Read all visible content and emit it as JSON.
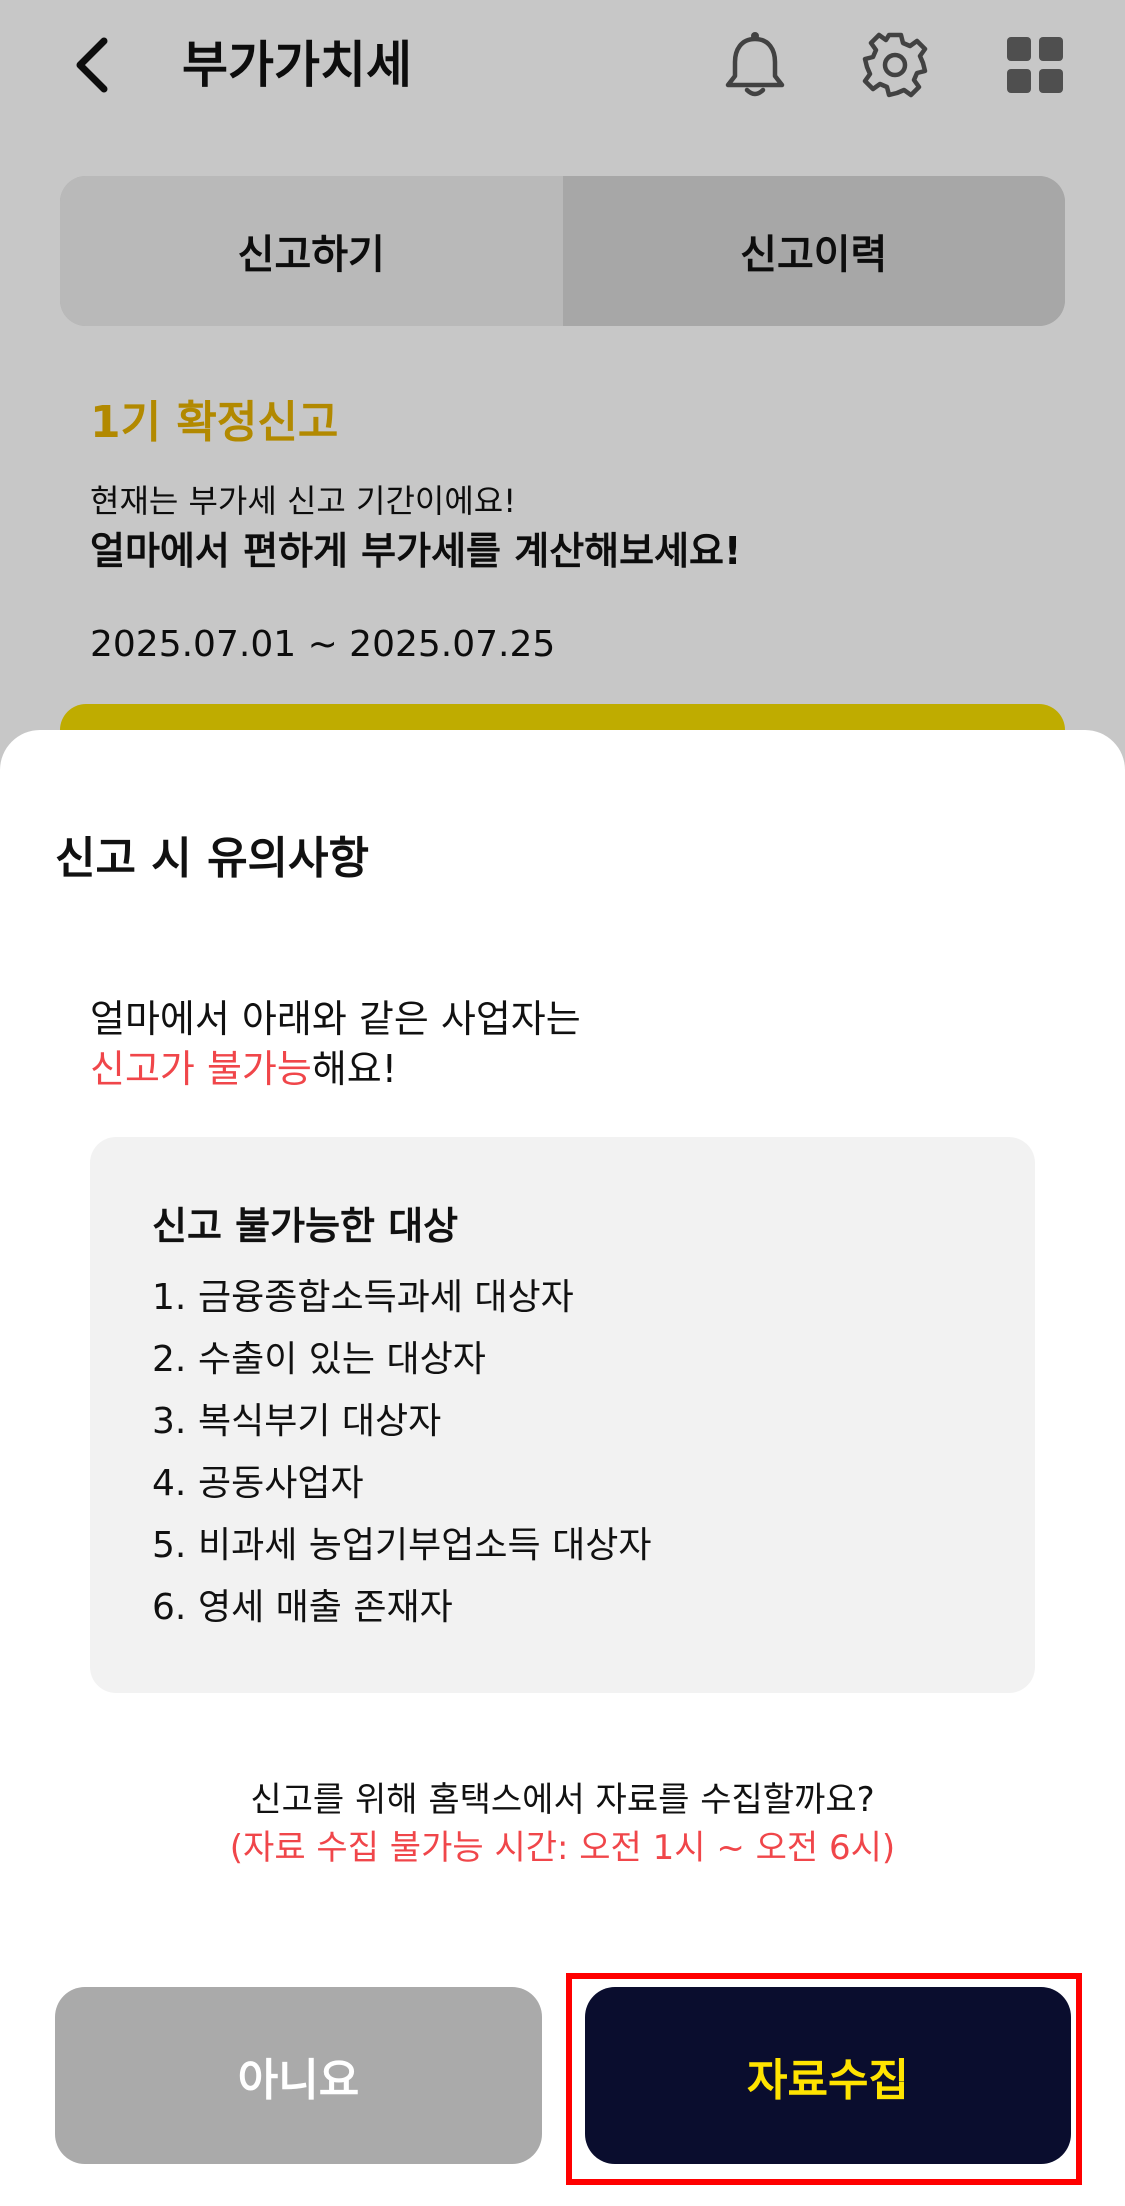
{
  "header": {
    "title": "부가가치세"
  },
  "tabs": [
    {
      "label": "신고하기",
      "active": true
    },
    {
      "label": "신고이력",
      "active": false
    }
  ],
  "info": {
    "period_title": "1기 확정신고",
    "line1": "현재는 부가세 신고 기간이에요!",
    "line2": "얼마에서 편하게 부가세를 계산해보세요!",
    "date_range": "2025.07.01 ~ 2025.07.25"
  },
  "sheet": {
    "title": "신고 시 유의사항",
    "notice_line1": "얼마에서 아래와 같은 사업자는",
    "notice_red": "신고가 불가능",
    "notice_tail": "해요!",
    "box_title": "신고 불가능한 대상",
    "items": [
      {
        "num": "1.",
        "text": "금융종합소득과세 대상자"
      },
      {
        "num": "2.",
        "text": "수출이 있는 대상자"
      },
      {
        "num": "3.",
        "text": "복식부기 대상자"
      },
      {
        "num": "4.",
        "text": "공동사업자"
      },
      {
        "num": "5.",
        "text": "비과세 농업기부업소득 대상자"
      },
      {
        "num": "6.",
        "text": "영세 매출 존재자"
      }
    ],
    "question": "신고를 위해 홈택스에서 자료를 수집할까요?",
    "question_note": "(자료 수집 불가능 시간: 오전 1시 ~ 오전 6시)",
    "no_label": "아니요",
    "yes_label": "자료수집"
  },
  "colors": {
    "accent_yellow": "#f5dd00",
    "period_gold": "#e5b000",
    "warning_red": "#f0464a",
    "primary_navy": "#0a0d2e",
    "highlight_frame": "#ff0000"
  },
  "icons": {
    "back": "chevron-left-icon",
    "bell": "bell-icon",
    "gear": "gear-icon",
    "grid": "grid-icon"
  }
}
